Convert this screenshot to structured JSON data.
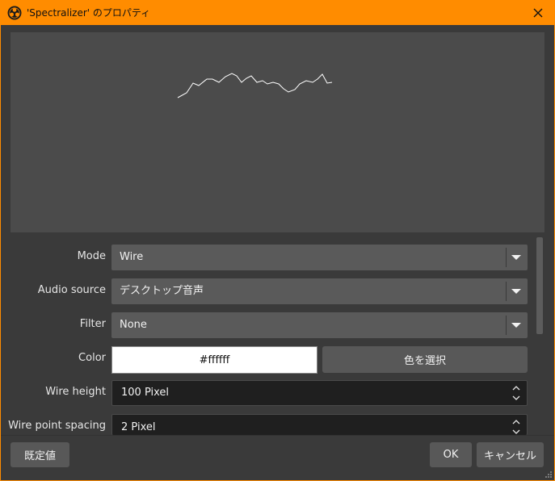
{
  "window": {
    "title": "'Spectralizer' のプロパティ",
    "accent_color": "#ff8c00"
  },
  "icons": {
    "app": "obs-logo-icon",
    "close": "close-icon",
    "dropdown": "chevron-down-icon",
    "spin": "spin-up-down-icon"
  },
  "form": {
    "mode": {
      "label": "Mode",
      "value": "Wire"
    },
    "audio_source": {
      "label": "Audio source",
      "value": "デスクトップ音声"
    },
    "filter": {
      "label": "Filter",
      "value": "None"
    },
    "color": {
      "label": "Color",
      "value": "#ffffff",
      "button": "色を選択"
    },
    "wire_height": {
      "label": "Wire height",
      "value": "100 Pixel"
    },
    "wire_point_spacing": {
      "label": "Wire point spacing",
      "value": "2 Pixel"
    }
  },
  "footer": {
    "defaults_button": "既定値",
    "ok_button": "OK",
    "cancel_button": "キャンセル"
  }
}
